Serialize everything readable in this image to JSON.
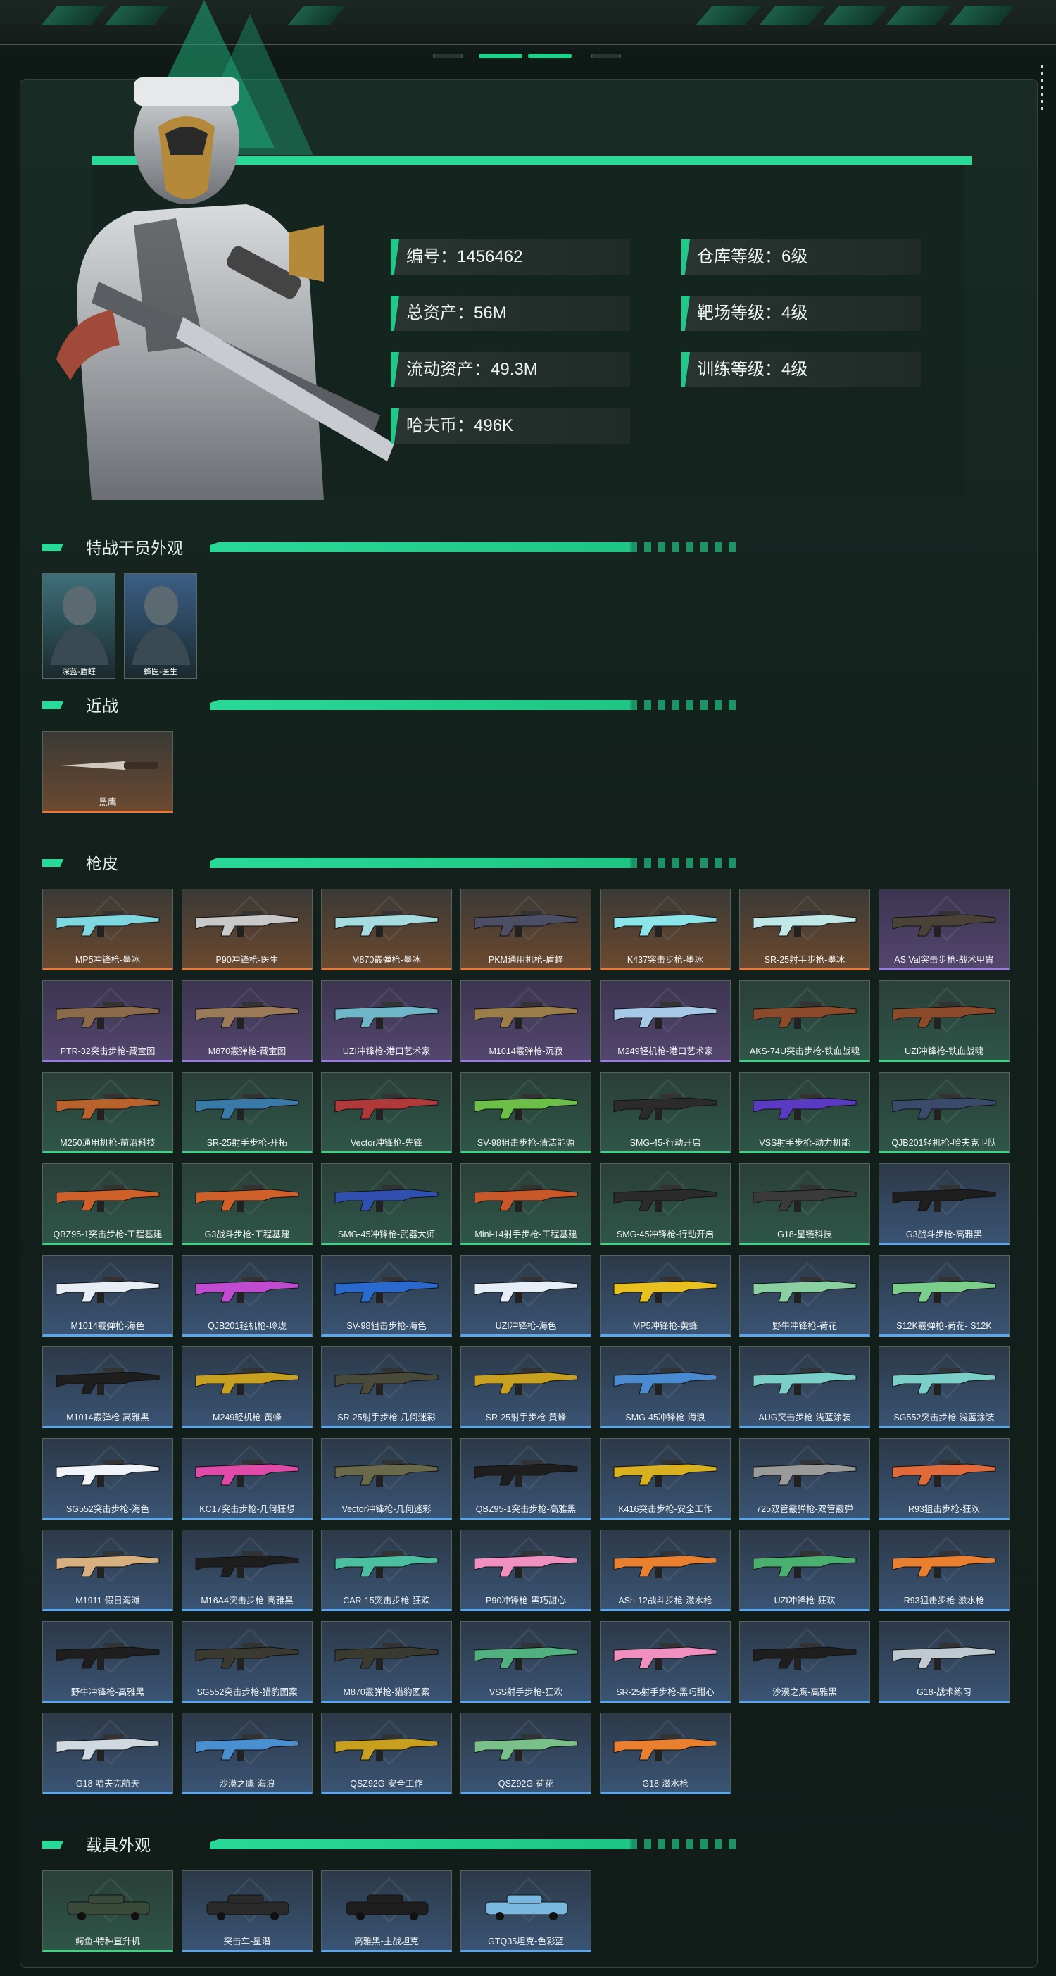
{
  "stats": [
    {
      "label": "编号：1456462"
    },
    {
      "label": "仓库等级：6级"
    },
    {
      "label": "总资产：56M"
    },
    {
      "label": "靶场等级：4级"
    },
    {
      "label": "流动资产：49.3M"
    },
    {
      "label": "训练等级：4级"
    },
    {
      "label": "哈夫币：496K"
    }
  ],
  "sections": {
    "operators": "特战干员外观",
    "melee": "近战",
    "skins": "枪皮",
    "vehicles": "载具外观"
  },
  "operators": [
    {
      "name": "深蓝-盾蝰",
      "tone": "#3e6f7a"
    },
    {
      "name": "蜂医-医生",
      "tone": "#3c5f86"
    }
  ],
  "melee": [
    {
      "name": "黑鹰",
      "rarity": "orange",
      "icon": "knife-icon"
    }
  ],
  "skins": [
    {
      "name": "MP5冲锋枪-墨冰",
      "rarity": "orange",
      "color": "#7fd8e0"
    },
    {
      "name": "P90冲锋枪-医生",
      "rarity": "orange",
      "color": "#c9c9c9"
    },
    {
      "name": "M870霰弹枪-墨冰",
      "rarity": "orange",
      "color": "#a6dcdf"
    },
    {
      "name": "PKM通用机枪-盾蝰",
      "rarity": "orange",
      "color": "#4c4e66"
    },
    {
      "name": "K437突击步枪-墨冰",
      "rarity": "orange",
      "color": "#8ce6e9"
    },
    {
      "name": "SR-25射手步枪-墨冰",
      "rarity": "orange",
      "color": "#bfe8e6"
    },
    {
      "name": "AS Val突击步枪-战术甲胄",
      "rarity": "purple",
      "color": "#4a4236"
    },
    {
      "name": "PTR-32突击步枪-藏宝图",
      "rarity": "purple",
      "color": "#8a6a4a"
    },
    {
      "name": "M870霰弹枪-藏宝图",
      "rarity": "purple",
      "color": "#9a7a58"
    },
    {
      "name": "UZI冲锋枪-港口艺术家",
      "rarity": "purple",
      "color": "#6fb6c9"
    },
    {
      "name": "M1014霰弹枪-沉寂",
      "rarity": "purple",
      "color": "#9b7d4a"
    },
    {
      "name": "M249轻机枪-港口艺术家",
      "rarity": "purple",
      "color": "#a7c9e8"
    },
    {
      "name": "AKS-74U突击步枪-铁血战魂",
      "rarity": "green",
      "color": "#8b4a2a"
    },
    {
      "name": "UZI冲锋枪-铁血战魂",
      "rarity": "green",
      "color": "#8b4a2a"
    },
    {
      "name": "M250通用机枪-前沿科技",
      "rarity": "green",
      "color": "#b8622e"
    },
    {
      "name": "SR-25射手步枪-开拓",
      "rarity": "green",
      "color": "#3a7aa8"
    },
    {
      "name": "Vector冲锋枪-先锋",
      "rarity": "green",
      "color": "#b03a3a"
    },
    {
      "name": "SV-98狙击步枪-清洁能源",
      "rarity": "green",
      "color": "#6cc04a"
    },
    {
      "name": "SMG-45-行动开启",
      "rarity": "green",
      "color": "#2b2b2b"
    },
    {
      "name": "VSS射手步枪-动力机能",
      "rarity": "green",
      "color": "#5a3ac0"
    },
    {
      "name": "QJB201轻机枪-哈夫克卫队",
      "rarity": "green",
      "color": "#3a4a6a"
    },
    {
      "name": "QBZ95-1突击步枪-工程基建",
      "rarity": "green",
      "color": "#d0602a"
    },
    {
      "name": "G3战斗步枪-工程基建",
      "rarity": "green",
      "color": "#d0602a"
    },
    {
      "name": "SMG-45冲锋枪-武器大师",
      "rarity": "green",
      "color": "#3050b0"
    },
    {
      "name": "Mini-14射手步枪-工程基建",
      "rarity": "green",
      "color": "#c8582a"
    },
    {
      "name": "SMG-45冲锋枪-行动开启",
      "rarity": "green",
      "color": "#2b2b2b"
    },
    {
      "name": "G18-星链科技",
      "rarity": "green",
      "color": "#3a3a3a"
    },
    {
      "name": "G3战斗步枪-高雅黑",
      "rarity": "blue",
      "color": "#1e1e1e"
    },
    {
      "name": "M1014霰弹枪-海色",
      "rarity": "blue",
      "color": "#e8eef5"
    },
    {
      "name": "QJB201轻机枪-玲珑",
      "rarity": "blue",
      "color": "#c04ad0"
    },
    {
      "name": "SV-98狙击步枪-海色",
      "rarity": "blue",
      "color": "#2a6ad0"
    },
    {
      "name": "UZI冲锋枪-海色",
      "rarity": "blue",
      "color": "#e6eef8"
    },
    {
      "name": "MP5冲锋枪-黄蜂",
      "rarity": "blue",
      "color": "#e8c020"
    },
    {
      "name": "野牛冲锋枪-荷花",
      "rarity": "blue",
      "color": "#8ad0a0"
    },
    {
      "name": "S12K霰弹枪-荷花- S12K",
      "rarity": "blue",
      "color": "#7ad08a"
    },
    {
      "name": "M1014霰弹枪-高雅黑",
      "rarity": "blue",
      "color": "#1e1e1e"
    },
    {
      "name": "M249轻机枪-黄蜂",
      "rarity": "blue",
      "color": "#c8a020"
    },
    {
      "name": "SR-25射手步枪-几何迷彩",
      "rarity": "blue",
      "color": "#4a4a3a"
    },
    {
      "name": "SR-25射手步枪-黄蜂",
      "rarity": "blue",
      "color": "#c8a020"
    },
    {
      "name": "SMG-45冲锋枪-海浪",
      "rarity": "blue",
      "color": "#4a8ad0"
    },
    {
      "name": "AUG突击步枪-浅蓝涂装",
      "rarity": "blue",
      "color": "#7ad0c8"
    },
    {
      "name": "SG552突击步枪-浅蓝涂装",
      "rarity": "blue",
      "color": "#7ad0c8"
    },
    {
      "name": "SG552突击步枪-海色",
      "rarity": "blue",
      "color": "#f0f4fa"
    },
    {
      "name": "KC17突击步枪-几何狂想",
      "rarity": "blue",
      "color": "#e04aa8"
    },
    {
      "name": "Vector冲锋枪-几何迷彩",
      "rarity": "blue",
      "color": "#6a6a4a"
    },
    {
      "name": "QBZ95-1突击步枪-高雅黑",
      "rarity": "blue",
      "color": "#1e1e1e"
    },
    {
      "name": "K416突击步枪-安全工作",
      "rarity": "blue",
      "color": "#d8b020"
    },
    {
      "name": "725双管霰弹枪-双管霰弹",
      "rarity": "blue",
      "color": "#9a9a9a"
    },
    {
      "name": "R93狙击步枪-狂欢",
      "rarity": "blue",
      "color": "#e06a3a"
    },
    {
      "name": "M1911-假日海滩",
      "rarity": "blue",
      "color": "#d8b080"
    },
    {
      "name": "M16A4突击步枪-高雅黑",
      "rarity": "blue",
      "color": "#1e1e1e"
    },
    {
      "name": "CAR-15突击步枪-狂欢",
      "rarity": "blue",
      "color": "#4ac0a0"
    },
    {
      "name": "P90冲锋枪-黑巧甜心",
      "rarity": "blue",
      "color": "#f090c0"
    },
    {
      "name": "ASh-12战斗步枪-滋水枪",
      "rarity": "blue",
      "color": "#e88030"
    },
    {
      "name": "UZI冲锋枪-狂欢",
      "rarity": "blue",
      "color": "#4ab070"
    },
    {
      "name": "R93狙击步枪-滋水枪",
      "rarity": "blue",
      "color": "#e88030"
    },
    {
      "name": "野牛冲锋枪-高雅黑",
      "rarity": "blue",
      "color": "#1e1e1e"
    },
    {
      "name": "SG552突击步枪-猎豹图案",
      "rarity": "blue",
      "color": "#3a3a30"
    },
    {
      "name": "M870霰弹枪-猎豹图案",
      "rarity": "blue",
      "color": "#3a3a30"
    },
    {
      "name": "VSS射手步枪-狂欢",
      "rarity": "blue",
      "color": "#50b080"
    },
    {
      "name": "SR-25射手步枪-黑巧甜心",
      "rarity": "blue",
      "color": "#f090c0"
    },
    {
      "name": "沙漠之鹰-高雅黑",
      "rarity": "blue",
      "color": "#1e1e1e"
    },
    {
      "name": "G18-战术练习",
      "rarity": "blue",
      "color": "#c0c8d0"
    },
    {
      "name": "G18-哈夫克航天",
      "rarity": "blue",
      "color": "#d0d8e0"
    },
    {
      "name": "沙漠之鹰-海浪",
      "rarity": "blue",
      "color": "#4a90d0"
    },
    {
      "name": "QSZ92G-安全工作",
      "rarity": "blue",
      "color": "#c8a020"
    },
    {
      "name": "QSZ92G-荷花",
      "rarity": "blue",
      "color": "#7ac08a"
    },
    {
      "name": "G18-滋水枪",
      "rarity": "blue",
      "color": "#e88030"
    }
  ],
  "vehicles": [
    {
      "name": "鳄鱼-特种直升机",
      "rarity": "green",
      "color": "#3a4a3a"
    },
    {
      "name": "突击车-星潜",
      "rarity": "blue",
      "color": "#2a2a2a"
    },
    {
      "name": "高雅黑-主战坦克",
      "rarity": "blue",
      "color": "#1e1e1e"
    },
    {
      "name": "GTQ35坦克-色彩蓝",
      "rarity": "blue",
      "color": "#7ab8e0"
    }
  ],
  "colors": {
    "accent": "#29d998",
    "orange": "#e8793a",
    "purple": "#9a7be0",
    "green": "#3ed488",
    "blue": "#5aa7f0"
  }
}
